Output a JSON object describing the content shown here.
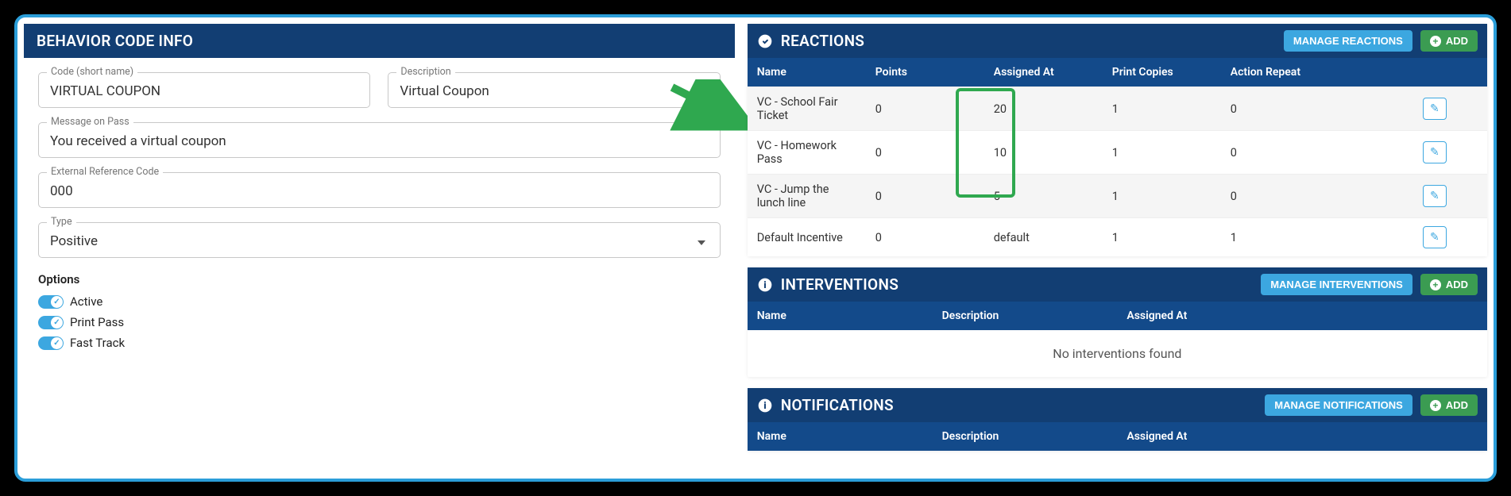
{
  "behavior": {
    "panel_title": "BEHAVIOR CODE INFO",
    "code_label": "Code (short name)",
    "code_value": "VIRTUAL COUPON",
    "desc_label": "Description",
    "desc_value": "Virtual Coupon",
    "msg_label": "Message on Pass",
    "msg_value": "You received a virtual coupon",
    "ext_label": "External Reference Code",
    "ext_value": "000",
    "type_label": "Type",
    "type_value": "Positive",
    "options_label": "Options",
    "opt_active": "Active",
    "opt_print": "Print Pass",
    "opt_fast": "Fast Track"
  },
  "reactions": {
    "title": "REACTIONS",
    "manage_btn": "MANAGE REACTIONS",
    "add_btn": "ADD",
    "columns": {
      "name": "Name",
      "points": "Points",
      "assigned": "Assigned At",
      "copies": "Print Copies",
      "repeat": "Action Repeat"
    },
    "rows": [
      {
        "name": "VC - School Fair Ticket",
        "points": "0",
        "assigned": "20",
        "copies": "1",
        "repeat": "0"
      },
      {
        "name": "VC - Homework Pass",
        "points": "0",
        "assigned": "10",
        "copies": "1",
        "repeat": "0"
      },
      {
        "name": "VC - Jump the lunch line",
        "points": "0",
        "assigned": "5",
        "copies": "1",
        "repeat": "0"
      },
      {
        "name": "Default Incentive",
        "points": "0",
        "assigned": "default",
        "copies": "1",
        "repeat": "1"
      }
    ]
  },
  "interventions": {
    "title": "INTERVENTIONS",
    "manage_btn": "MANAGE INTERVENTIONS",
    "add_btn": "ADD",
    "columns": {
      "name": "Name",
      "desc": "Description",
      "assigned": "Assigned At"
    },
    "empty": "No interventions found"
  },
  "notifications": {
    "title": "NOTIFICATIONS",
    "manage_btn": "MANAGE NOTIFICATIONS",
    "add_btn": "ADD",
    "columns": {
      "name": "Name",
      "desc": "Description",
      "assigned": "Assigned At"
    }
  }
}
